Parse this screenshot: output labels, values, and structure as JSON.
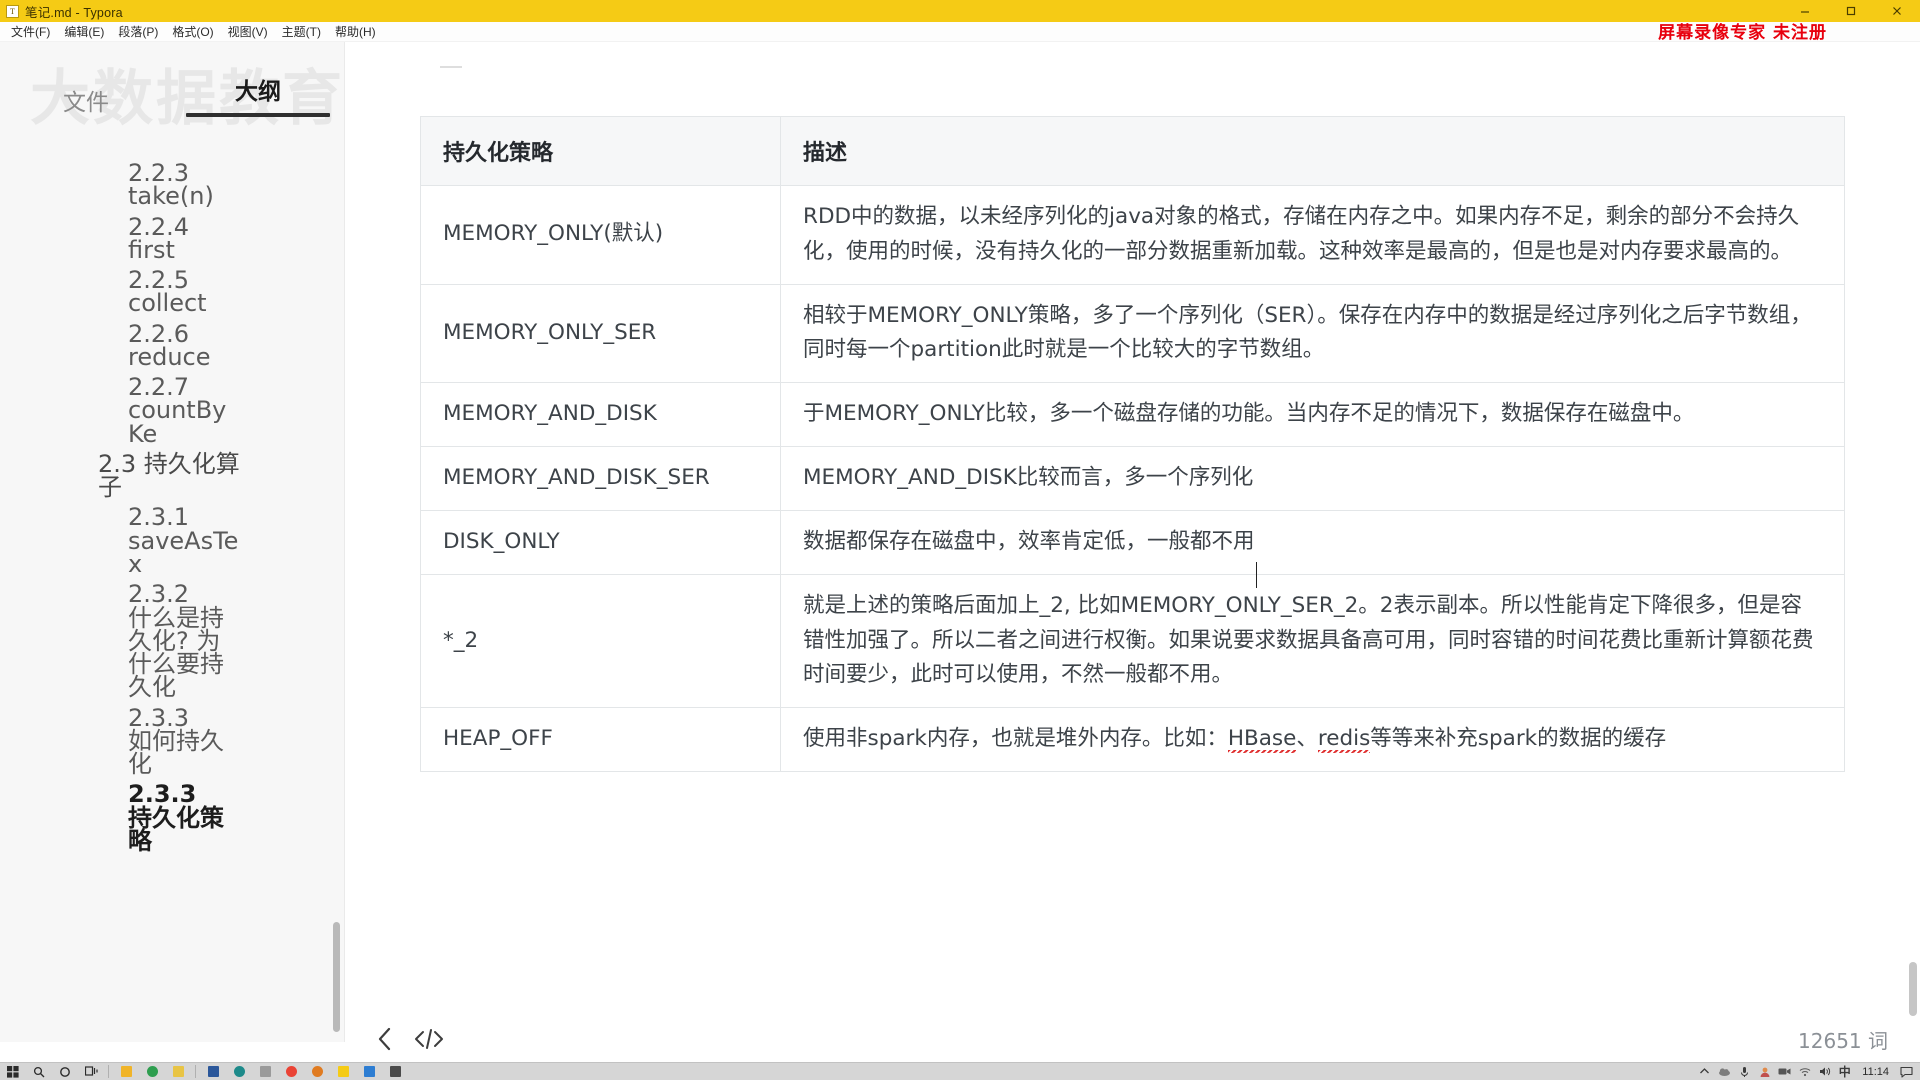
{
  "window": {
    "title": "笔记.md - Typora",
    "app_icon": "T",
    "controls": [
      {
        "name": "minimize",
        "glyph": "—"
      },
      {
        "name": "restore",
        "glyph": "❐"
      },
      {
        "name": "close",
        "glyph": "✕"
      }
    ]
  },
  "menubar": {
    "items": [
      {
        "label": "文件(F)",
        "name": "menu-file"
      },
      {
        "label": "编辑(E)",
        "name": "menu-edit"
      },
      {
        "label": "段落(P)",
        "name": "menu-paragraph"
      },
      {
        "label": "格式(O)",
        "name": "menu-format"
      },
      {
        "label": "视图(V)",
        "name": "menu-view"
      },
      {
        "label": "主题(T)",
        "name": "menu-theme"
      },
      {
        "label": "帮助(H)",
        "name": "menu-help"
      }
    ]
  },
  "overlay": {
    "recorder_watermark": "屏幕录像专家 未注册",
    "recorder_watermark_color": "#e8000d",
    "sidebar_watermark": "大数据教育"
  },
  "sidebar": {
    "tabs": [
      {
        "label": "文件",
        "active": false
      },
      {
        "label": "大纲",
        "active": true
      }
    ],
    "outline": [
      {
        "num": "2.2.3",
        "title": "take(n)",
        "level": 2,
        "current": false
      },
      {
        "num": "2.2.4",
        "title": "first",
        "level": 2,
        "current": false
      },
      {
        "num": "2.2.5",
        "title": "collect",
        "level": 2,
        "current": false
      },
      {
        "num": "2.2.6",
        "title": "reduce",
        "level": 2,
        "current": false
      },
      {
        "num": "2.2.7",
        "title": "countByKe",
        "level": 2,
        "current": false
      },
      {
        "num": "2.3",
        "title": "持久化算子",
        "level": 1,
        "current": false
      },
      {
        "num": "2.3.1",
        "title": "saveAsTex",
        "level": 2,
        "current": false
      },
      {
        "num": "2.3.2",
        "title": "什么是持久化? 为什么要持久化",
        "level": 2,
        "current": false
      },
      {
        "num": "2.3.3",
        "title": "如何持久化",
        "level": 2,
        "current": false
      },
      {
        "num": "2.3.3",
        "title": "持久化策略",
        "level": 2,
        "current": true
      }
    ]
  },
  "document": {
    "table": {
      "headers": [
        "持久化策略",
        "描述"
      ],
      "rows": [
        {
          "strategy": "MEMORY_ONLY(默认)",
          "description": "RDD中的数据，以未经序列化的java对象的格式，存储在内存之中。如果内存不足，剩余的部分不会持久化，使用的时候，没有持久化的一部分数据重新加载。这种效率是最高的，但是也是对内存要求最高的。"
        },
        {
          "strategy": "MEMORY_ONLY_SER",
          "description": "相较于MEMORY_ONLY策略，多了一个序列化（SER）。保存在内存中的数据是经过序列化之后字节数组，同时每一个partition此时就是一个比较大的字节数组。"
        },
        {
          "strategy": "MEMORY_AND_DISK",
          "description": "于MEMORY_ONLY比较，多一个磁盘存储的功能。当内存不足的情况下，数据保存在磁盘中。"
        },
        {
          "strategy": "MEMORY_AND_DISK_SER",
          "description": "MEMORY_AND_DISK比较而言，多一个序列化"
        },
        {
          "strategy": "DISK_ONLY",
          "description": "数据都保存在磁盘中，效率肯定低，一般都不用"
        },
        {
          "strategy": "*_2",
          "description": "就是上述的策略后面加上_2, 比如MEMORY_ONLY_SER_2。2表示副本。所以性能肯定下降很多，但是容错性加强了。所以二者之间进行权衡。如果说要求数据具备高可用，同时容错的时间花费比重新计算额花费时间要少，此时可以使用，不然一般都不用。"
        },
        {
          "strategy": "HEAP_OFF",
          "description_parts": [
            {
              "text": "使用非spark内存，也就是堆外内存。比如：",
              "misspelled": false
            },
            {
              "text": "HBase",
              "misspelled": true
            },
            {
              "text": "、",
              "misspelled": false
            },
            {
              "text": "redis",
              "misspelled": true
            },
            {
              "text": "等等来补充spark的数据的缓存",
              "misspelled": false
            }
          ]
        }
      ]
    }
  },
  "statusbar": {
    "back_icon": "back-chevron",
    "source_icon": "</>",
    "word_count": "12651 词"
  },
  "taskbar": {
    "start": "windows-start",
    "pinned": [
      {
        "name": "search-icon",
        "color": "#3b3b3b"
      },
      {
        "name": "cortana-icon",
        "color": "#3b3b3b"
      },
      {
        "name": "taskview-icon",
        "color": "#3b3b3b"
      },
      {
        "name": "explorer-icon",
        "color": "#f0b429"
      },
      {
        "name": "app-green-icon",
        "color": "#2e9e4f"
      },
      {
        "name": "word-icon",
        "color": "#2b579a"
      },
      {
        "name": "app-teal-icon",
        "color": "#1d8a8a"
      },
      {
        "name": "typora-icon",
        "color": "#f5cb15"
      },
      {
        "name": "browser-icon",
        "color": "#4285f4"
      },
      {
        "name": "notes-icon",
        "color": "#c0c0c0"
      },
      {
        "name": "chrome-icon",
        "color": "#ea4335"
      },
      {
        "name": "terminal-icon",
        "color": "#333333"
      },
      {
        "name": "folder2-icon",
        "color": "#f0b429"
      },
      {
        "name": "app-blue-icon",
        "color": "#2d7dd2"
      }
    ],
    "tray": [
      {
        "name": "show-hidden-icon",
        "glyph": "∧"
      },
      {
        "name": "cloud-icon",
        "glyph": "☁"
      },
      {
        "name": "mic-icon",
        "glyph": "Ἲ4"
      },
      {
        "name": "user-icon",
        "glyph": "◉"
      },
      {
        "name": "camera-icon",
        "glyph": "▣"
      },
      {
        "name": "network-icon",
        "glyph": "◥"
      },
      {
        "name": "volume-icon",
        "glyph": "ὐA"
      },
      {
        "name": "ime-icon",
        "glyph": "中"
      }
    ],
    "clock": "11:14",
    "notifications_icon": "notification-icon"
  }
}
